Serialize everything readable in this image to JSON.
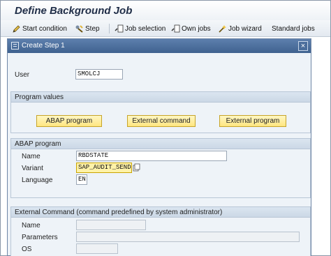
{
  "page": {
    "title": "Define Background Job"
  },
  "toolbar": {
    "start_condition": "Start condition",
    "step": "Step",
    "job_selection": "Job selection",
    "own_jobs": "Own jobs",
    "job_wizard": "Job wizard",
    "standard_jobs": "Standard jobs"
  },
  "dialog": {
    "title": "Create Step  1",
    "close": "×",
    "user_label": "User",
    "user_value": "SMOLCJ",
    "program_values": {
      "title": "Program values",
      "abap_program_button": "ABAP program",
      "external_command_button": "External command",
      "external_program_button": "External program"
    },
    "abap_program": {
      "title": "ABAP program",
      "name_label": "Name",
      "name_value": "RBDSTATE",
      "variant_label": "Variant",
      "variant_value": "SAP_AUDIT_SEND",
      "language_label": "Language",
      "language_value": "EN"
    },
    "external_command": {
      "title": "External Command (command predefined by system administrator)",
      "name_label": "Name",
      "parameters_label": "Parameters",
      "os_label": "OS"
    }
  }
}
